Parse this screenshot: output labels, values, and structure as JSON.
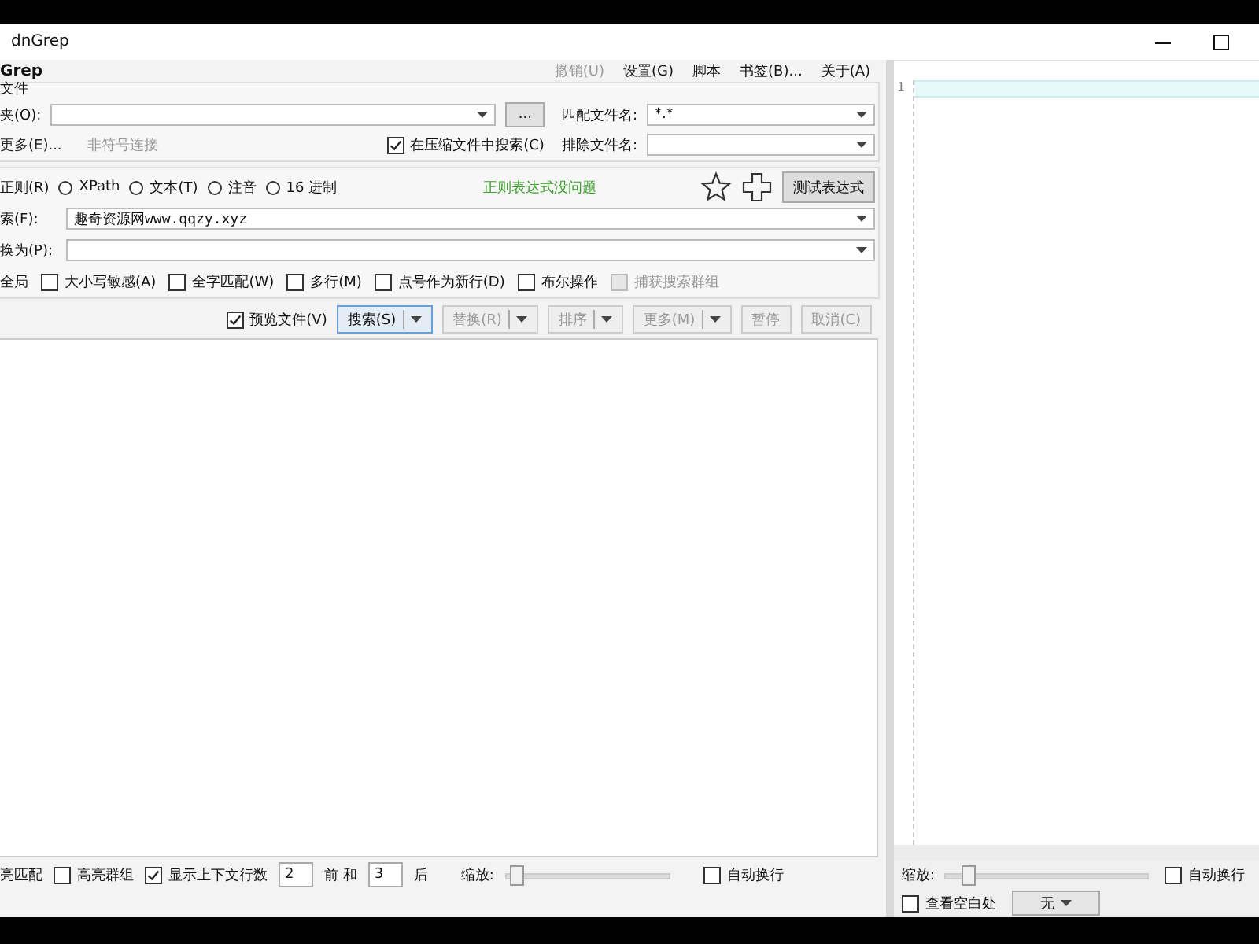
{
  "window": {
    "title": "dnGrep"
  },
  "menu": {
    "app_title": "Grep",
    "items": [
      {
        "label": "撤销(U)",
        "disabled": true
      },
      {
        "label": "设置(G)",
        "disabled": false
      },
      {
        "label": "脚本",
        "disabled": false
      },
      {
        "label": "书签(B)...",
        "disabled": false
      },
      {
        "label": "关于(A)",
        "disabled": false
      }
    ]
  },
  "file_group": {
    "title": "文件",
    "folder_label": "夹(O):",
    "browse_button": "...",
    "match_label": "匹配文件名:",
    "match_value": "*.*",
    "more_link": "更多(E)...",
    "symlink_label": "非符号连接",
    "archive": {
      "label": "在压缩文件中搜索(C)",
      "checked": true
    },
    "exclude_label": "排除文件名:"
  },
  "search_group": {
    "regex_label": "正则(R)",
    "types": [
      {
        "label": "XPath",
        "selected": false
      },
      {
        "label": "文本(T)",
        "selected": false
      },
      {
        "label": "注音",
        "selected": false
      },
      {
        "label": "16 进制",
        "selected": false
      }
    ],
    "status": "正则表达式没问题",
    "test_button": "测试表达式",
    "search_label": "索(F):",
    "search_value": "趣奇资源网www.qqzy.xyz",
    "replace_label": "换为(P):",
    "global_label": "全局",
    "options": [
      {
        "label": "大小写敏感(A)",
        "checked": false,
        "disabled": false
      },
      {
        "label": "全字匹配(W)",
        "checked": false,
        "disabled": false
      },
      {
        "label": "多行(M)",
        "checked": false,
        "disabled": false
      },
      {
        "label": "点号作为新行(D)",
        "checked": false,
        "disabled": false
      },
      {
        "label": "布尔操作",
        "checked": false,
        "disabled": false
      },
      {
        "label": "捕获搜索群组",
        "checked": false,
        "disabled": true
      }
    ]
  },
  "toolbar": {
    "preview": {
      "label": "预览文件(V)",
      "checked": true
    },
    "buttons": [
      {
        "label": "搜索(S)",
        "disabled": false,
        "dropdown": true
      },
      {
        "label": "替换(R)",
        "disabled": true,
        "dropdown": true
      },
      {
        "label": "排序",
        "disabled": true,
        "dropdown": true
      },
      {
        "label": "更多(M)",
        "disabled": true,
        "dropdown": true
      },
      {
        "label": "暂停",
        "disabled": true,
        "dropdown": false
      },
      {
        "label": "取消(C)",
        "disabled": true,
        "dropdown": false
      }
    ]
  },
  "bottom": {
    "highlight_label": "亮匹配",
    "highlight_groups": {
      "label": "高亮群组",
      "checked": false
    },
    "context": {
      "label": "显示上下文行数",
      "checked": true
    },
    "before_value": "2",
    "between_label": "前 和",
    "after_value": "3",
    "after_label": "后",
    "zoom_label": "缩放:",
    "zoom": {
      "level": 0.05
    },
    "wrap": {
      "label": "自动换行",
      "checked": false
    }
  },
  "preview": {
    "line_numbers": [
      "1"
    ],
    "zoom_label": "缩放:",
    "zoom": {
      "level": 0.1
    },
    "wrap": {
      "label": "自动换行",
      "checked": false
    },
    "whitespace": {
      "label": "查看空白处",
      "checked": false
    },
    "dropdown": "无"
  }
}
